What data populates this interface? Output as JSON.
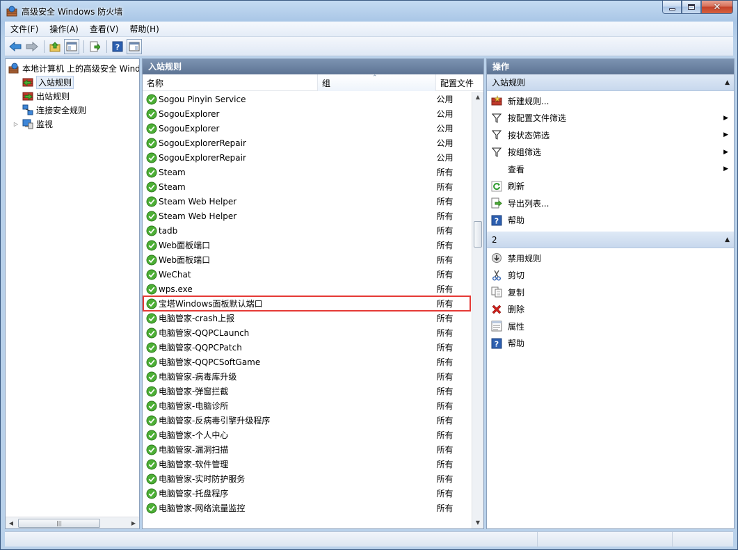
{
  "window": {
    "title": "高级安全 Windows 防火墙"
  },
  "menu": [
    "文件(F)",
    "操作(A)",
    "查看(V)",
    "帮助(H)"
  ],
  "tree": {
    "root": "本地计算机 上的高级安全 Windows 防火墙",
    "items": [
      {
        "label": "入站规则",
        "selected": true
      },
      {
        "label": "出站规则",
        "selected": false
      },
      {
        "label": "连接安全规则",
        "selected": false
      },
      {
        "label": "监视",
        "selected": false,
        "expandable": true
      }
    ]
  },
  "middle": {
    "header": "入站规则",
    "columns": {
      "name": "名称",
      "group": "组",
      "profile": "配置文件"
    },
    "highlighted_index": 14,
    "rules": [
      {
        "name": "Sogou Pinyin Service",
        "profile": "公用"
      },
      {
        "name": "SogouExplorer",
        "profile": "公用"
      },
      {
        "name": "SogouExplorer",
        "profile": "公用"
      },
      {
        "name": "SogouExplorerRepair",
        "profile": "公用"
      },
      {
        "name": "SogouExplorerRepair",
        "profile": "公用"
      },
      {
        "name": "Steam",
        "profile": "所有"
      },
      {
        "name": "Steam",
        "profile": "所有"
      },
      {
        "name": "Steam Web Helper",
        "profile": "所有"
      },
      {
        "name": "Steam Web Helper",
        "profile": "所有"
      },
      {
        "name": "tadb",
        "profile": "所有"
      },
      {
        "name": "Web面板端口",
        "profile": "所有"
      },
      {
        "name": "Web面板端口",
        "profile": "所有"
      },
      {
        "name": "WeChat",
        "profile": "所有"
      },
      {
        "name": "wps.exe",
        "profile": "所有"
      },
      {
        "name": "宝塔Windows面板默认端口",
        "profile": "所有"
      },
      {
        "name": "电脑管家-crash上报",
        "profile": "所有"
      },
      {
        "name": "电脑管家-QQPCLaunch",
        "profile": "所有"
      },
      {
        "name": "电脑管家-QQPCPatch",
        "profile": "所有"
      },
      {
        "name": "电脑管家-QQPCSoftGame",
        "profile": "所有"
      },
      {
        "name": "电脑管家-病毒库升级",
        "profile": "所有"
      },
      {
        "name": "电脑管家-弹窗拦截",
        "profile": "所有"
      },
      {
        "name": "电脑管家-电脑诊所",
        "profile": "所有"
      },
      {
        "name": "电脑管家-反病毒引擎升级程序",
        "profile": "所有"
      },
      {
        "name": "电脑管家-个人中心",
        "profile": "所有"
      },
      {
        "name": "电脑管家-漏洞扫描",
        "profile": "所有"
      },
      {
        "name": "电脑管家-软件管理",
        "profile": "所有"
      },
      {
        "name": "电脑管家-实时防护服务",
        "profile": "所有"
      },
      {
        "name": "电脑管家-托盘程序",
        "profile": "所有"
      },
      {
        "name": "电脑管家-网络流量监控",
        "profile": "所有"
      }
    ]
  },
  "actions": {
    "header": "操作",
    "section1": {
      "title": "入站规则",
      "items": [
        {
          "label": "新建规则...",
          "icon": "new-rule-icon"
        },
        {
          "label": "按配置文件筛选",
          "icon": "filter-icon",
          "submenu": true
        },
        {
          "label": "按状态筛选",
          "icon": "filter-icon",
          "submenu": true
        },
        {
          "label": "按组筛选",
          "icon": "filter-icon",
          "submenu": true
        },
        {
          "label": "查看",
          "icon": "",
          "submenu": true
        },
        {
          "label": "刷新",
          "icon": "refresh-icon"
        },
        {
          "label": "导出列表...",
          "icon": "export-icon"
        },
        {
          "label": "帮助",
          "icon": "help-icon"
        }
      ]
    },
    "section2": {
      "title": "2",
      "items": [
        {
          "label": "禁用规则",
          "icon": "disable-icon"
        },
        {
          "label": "剪切",
          "icon": "cut-icon"
        },
        {
          "label": "复制",
          "icon": "copy-icon"
        },
        {
          "label": "删除",
          "icon": "delete-icon"
        },
        {
          "label": "属性",
          "icon": "properties-icon"
        },
        {
          "label": "帮助",
          "icon": "help-icon"
        }
      ]
    }
  },
  "colors": {
    "rule_enabled": "#4caf35",
    "highlight": "#e53935",
    "pane_header": "#5d7494"
  }
}
